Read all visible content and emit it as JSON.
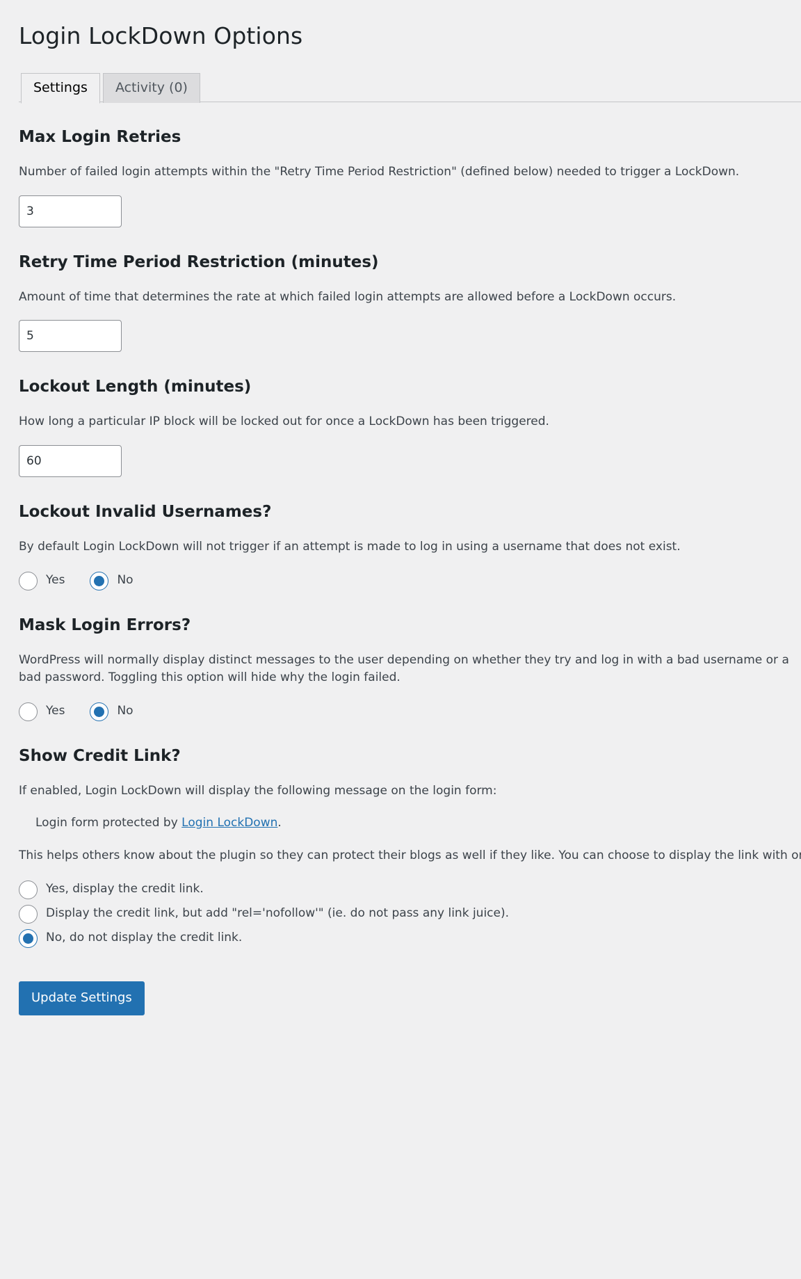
{
  "page": {
    "title": "Login LockDown Options"
  },
  "tabs": [
    {
      "label": "Settings",
      "active": true
    },
    {
      "label": "Activity (0)",
      "active": false
    }
  ],
  "sections": {
    "max_login_retries": {
      "heading": "Max Login Retries",
      "description": "Number of failed login attempts within the \"Retry Time Period Restriction\" (defined below) needed to trigger a LockDown.",
      "value": "3"
    },
    "retry_time_period": {
      "heading": "Retry Time Period Restriction (minutes)",
      "description": "Amount of time that determines the rate at which failed login attempts are allowed before a LockDown occurs.",
      "value": "5"
    },
    "lockout_length": {
      "heading": "Lockout Length (minutes)",
      "description": "How long a particular IP block will be locked out for once a LockDown has been triggered.",
      "value": "60"
    },
    "lockout_invalid_usernames": {
      "heading": "Lockout Invalid Usernames?",
      "description": "By default Login LockDown will not trigger if an attempt is made to log in using a username that does not exist.",
      "options": [
        {
          "label": "Yes",
          "checked": false
        },
        {
          "label": "No",
          "checked": true
        }
      ]
    },
    "mask_login_errors": {
      "heading": "Mask Login Errors?",
      "description": "WordPress will normally display distinct messages to the user depending on whether they try and log in with a bad username or a bad password. Toggling this option will hide why the login failed.",
      "options": [
        {
          "label": "Yes",
          "checked": false
        },
        {
          "label": "No",
          "checked": true
        }
      ]
    },
    "show_credit_link": {
      "heading": "Show Credit Link?",
      "description": "If enabled, Login LockDown will display the following message on the login form:",
      "sample_prefix": "Login form protected by ",
      "sample_link": "Login LockDown",
      "sample_suffix": ".",
      "note": "This helps others know about the plugin so they can protect their blogs as well if they like. You can choose to display the link with or without a nofollow attribute.",
      "options": [
        {
          "label": "Yes, display the credit link.",
          "checked": false
        },
        {
          "label": "Display the credit link, but add \"rel='nofollow'\" (ie. do not pass any link juice).",
          "checked": false
        },
        {
          "label": "No, do not display the credit link.",
          "checked": true
        }
      ]
    }
  },
  "submit": {
    "label": "Update Settings"
  },
  "colors": {
    "accent": "#2271b1",
    "background": "#f0f0f1",
    "heading": "#1d2327",
    "text": "#3c434a",
    "border": "#c3c4c7",
    "input_border": "#8c8f94"
  }
}
